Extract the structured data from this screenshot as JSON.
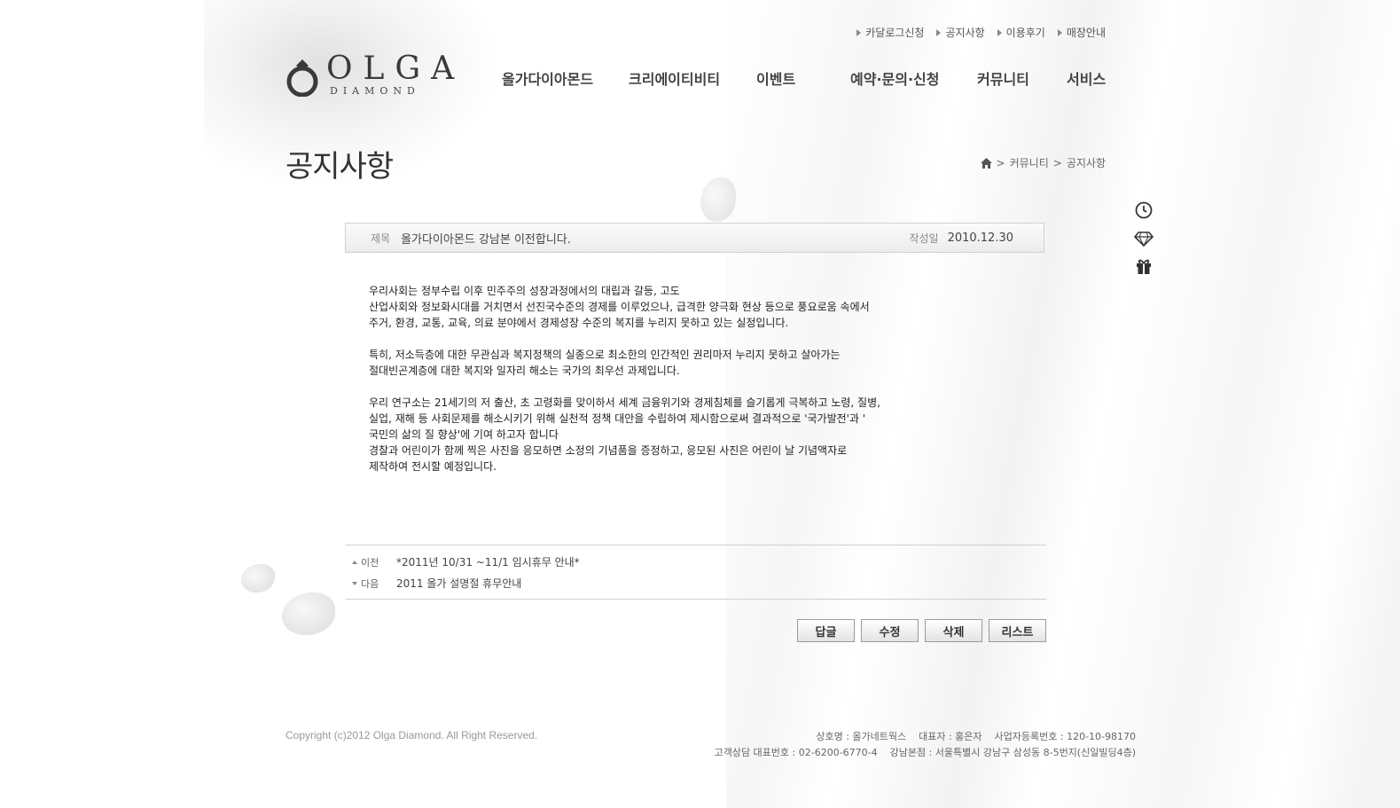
{
  "top_links": [
    "카달로그신청",
    "공지사항",
    "이용후기",
    "매장안내"
  ],
  "logo": {
    "main": "OLGA",
    "sub": "DIAMOND"
  },
  "nav": [
    "올가다이아몬드",
    "크리에이티비티",
    "이벤트",
    "예약·문의·신청",
    "커뮤니티",
    "서비스"
  ],
  "page_title": "공지사항",
  "breadcrumb": {
    "section": "커뮤니티",
    "current": "공지사항"
  },
  "post": {
    "subject_label": "제목",
    "subject": "올가다이아몬드 강남본 이전합니다.",
    "date_label": "작성일",
    "date": "2010.12.30",
    "paragraphs": [
      "우리사회는 정부수립 이후 민주주의 성장과정에서의 대립과 갈등, 고도\n산업사회와 정보화시대를 거치면서 선진국수준의 경제를 이루었으나, 급격한 양극화 현상 등으로 풍요로움 속에서\n주거, 환경, 교통, 교육, 의료 분야에서 경제성장 수준의 복지를 누리지 못하고 있는 실정입니다.",
      "특히, 저소득층에 대한 무관심과 복지정책의 실종으로 최소한의 인간적인 권리마저 누리지 못하고 살아가는\n절대빈곤계층에 대한 복지와 일자리 해소는 국가의 최우선 과제입니다.",
      "우리 연구소는 21세기의 저 출산, 초 고령화를 맞이하서 세계 금융위기와 경제침체를 슬기롭게 극복하고 노령, 질병,\n실업, 재해 등 사회문제를 해소시키기 위해 실천적 정책 대안을 수립하여 제시함으로써 결과적으로 '국가발전'과 '\n국민의 삶의 질 향상'에 기여 하고자 합니다\n경찰과 어린이가 함께 찍은 사진을 응모하면 소정의 기념품을 증정하고, 응모된 사진은 어린이 날 기념액자로\n제작하여 전시할 예정입니다."
    ]
  },
  "prev": {
    "label": "이전",
    "title": "*2011년 10/31 ~11/1 임시휴무 안내*"
  },
  "next": {
    "label": "다음",
    "title": "2011 올가 설명절 휴무안내"
  },
  "buttons": {
    "reply": "답글",
    "edit": "수정",
    "delete": "삭제",
    "list": "리스트"
  },
  "footer": {
    "copyright": "Copyright (c)2012 Olga Diamond. All Right Reserved.",
    "company_line1": "상호명 : 올가네트웍스    대표자 : 홍은자    사업자등록번호 : 120-10-98170",
    "company_line2": "고객상담 대표번호 : 02-6200-6770-4    강남본점 : 서울특별시 강남구 삼성동 8-5번지(신일빌딩4층)"
  },
  "quick_icons": [
    "clock-icon",
    "diamond-icon",
    "gift-icon"
  ],
  "colors": {
    "text": "#222222",
    "muted": "#888888",
    "border": "#d0d0d0"
  }
}
